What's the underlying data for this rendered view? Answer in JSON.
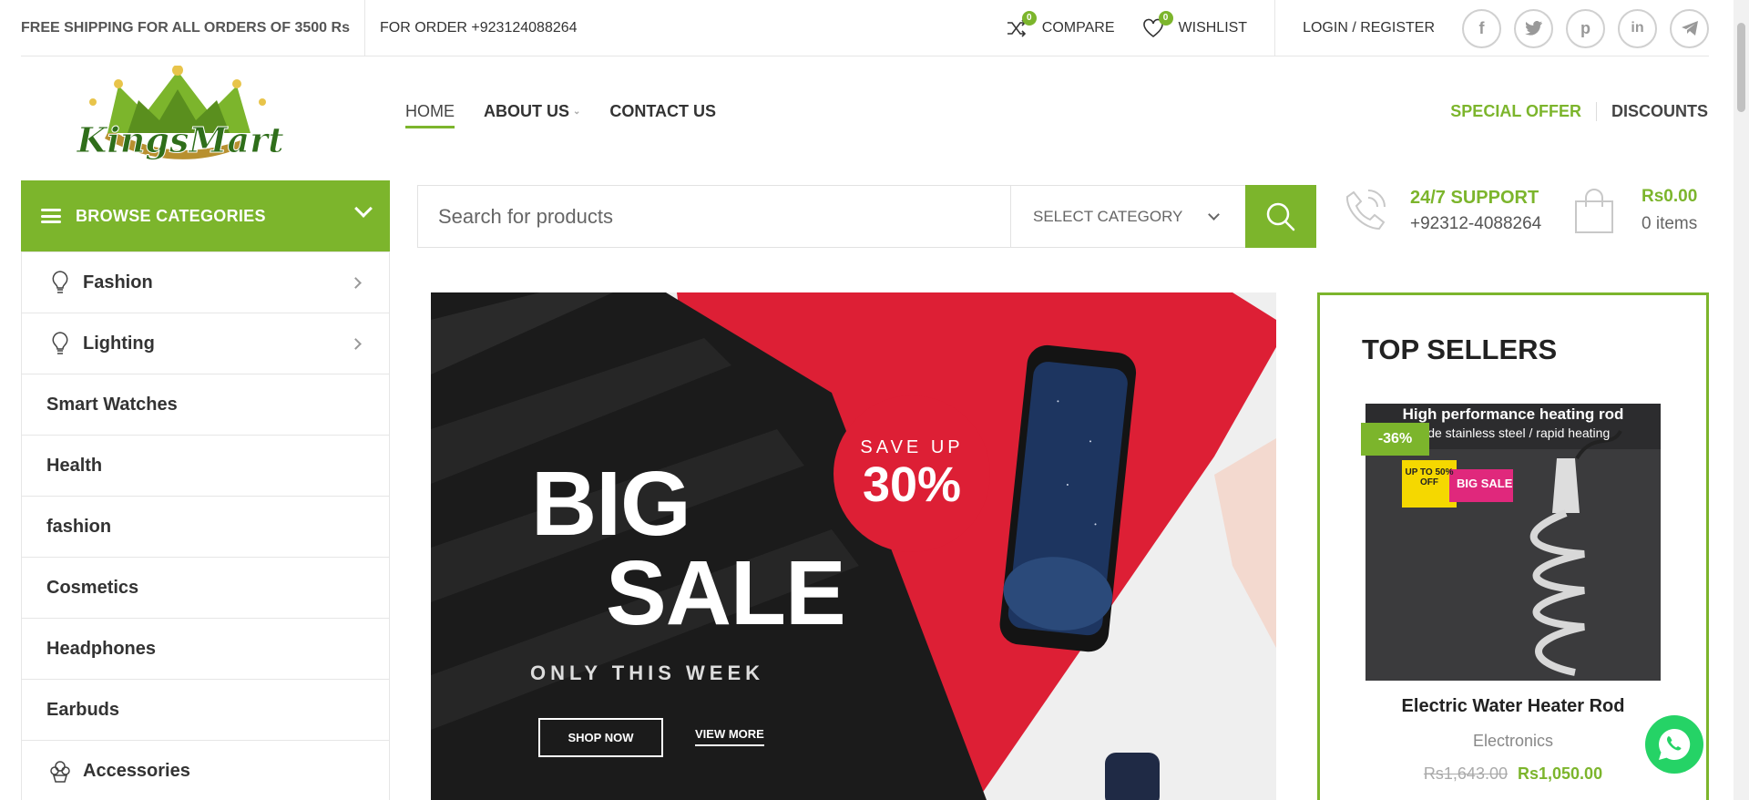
{
  "topbar": {
    "shipping": "FREE SHIPPING FOR ALL ORDERS OF 3500 Rs",
    "order": "FOR ORDER +923124088264",
    "compare_label": "COMPARE",
    "compare_count": "0",
    "wishlist_label": "WISHLIST",
    "wishlist_count": "0",
    "login": "LOGIN / REGISTER",
    "social": [
      "facebook-icon",
      "twitter-icon",
      "pinterest-icon",
      "linkedin-icon",
      "telegram-icon"
    ]
  },
  "logo": {
    "text": "KingsMart"
  },
  "nav": {
    "home": "HOME",
    "about": "ABOUT US",
    "contact": "CONTACT US",
    "special": "SPECIAL OFFER",
    "discounts": "DISCOUNTS"
  },
  "browse": {
    "label": "BROWSE CATEGORIES"
  },
  "categories": [
    {
      "label": "Fashion"
    },
    {
      "label": "Lighting"
    },
    {
      "label": "Smart Watches"
    },
    {
      "label": "Health"
    },
    {
      "label": "fashion"
    },
    {
      "label": "Cosmetics"
    },
    {
      "label": "Headphones"
    },
    {
      "label": "Earbuds"
    },
    {
      "label": "Accessories"
    }
  ],
  "search": {
    "placeholder": "Search for products",
    "category": "SELECT CATEGORY"
  },
  "support": {
    "title": "24/7 SUPPORT",
    "phone": "+92312-4088264"
  },
  "cart": {
    "amount": "Rs0.00",
    "items": "0 items"
  },
  "banner": {
    "big": "BIG",
    "sale": "SALE",
    "save_up": "SAVE UP",
    "save_pct": "30%",
    "subtitle": "ONLY THIS WEEK",
    "shop_now": "SHOP NOW",
    "view_more": "VIEW MORE"
  },
  "top_sellers": {
    "title": "TOP SELLERS",
    "product": {
      "img_line1": "High performance heating rod",
      "img_line2": "rade stainless steel / rapid heating",
      "img_badge1": "UP TO 50% OFF",
      "img_badge2": "BIG SALE",
      "discount": "-36%",
      "name": "Electric Water Heater Rod",
      "category": "Electronics",
      "old_price": "Rs1,643.00",
      "new_price": "Rs1,050.00"
    }
  },
  "colors": {
    "accent": "#7cb52c",
    "sale_red": "#dd1f35"
  }
}
